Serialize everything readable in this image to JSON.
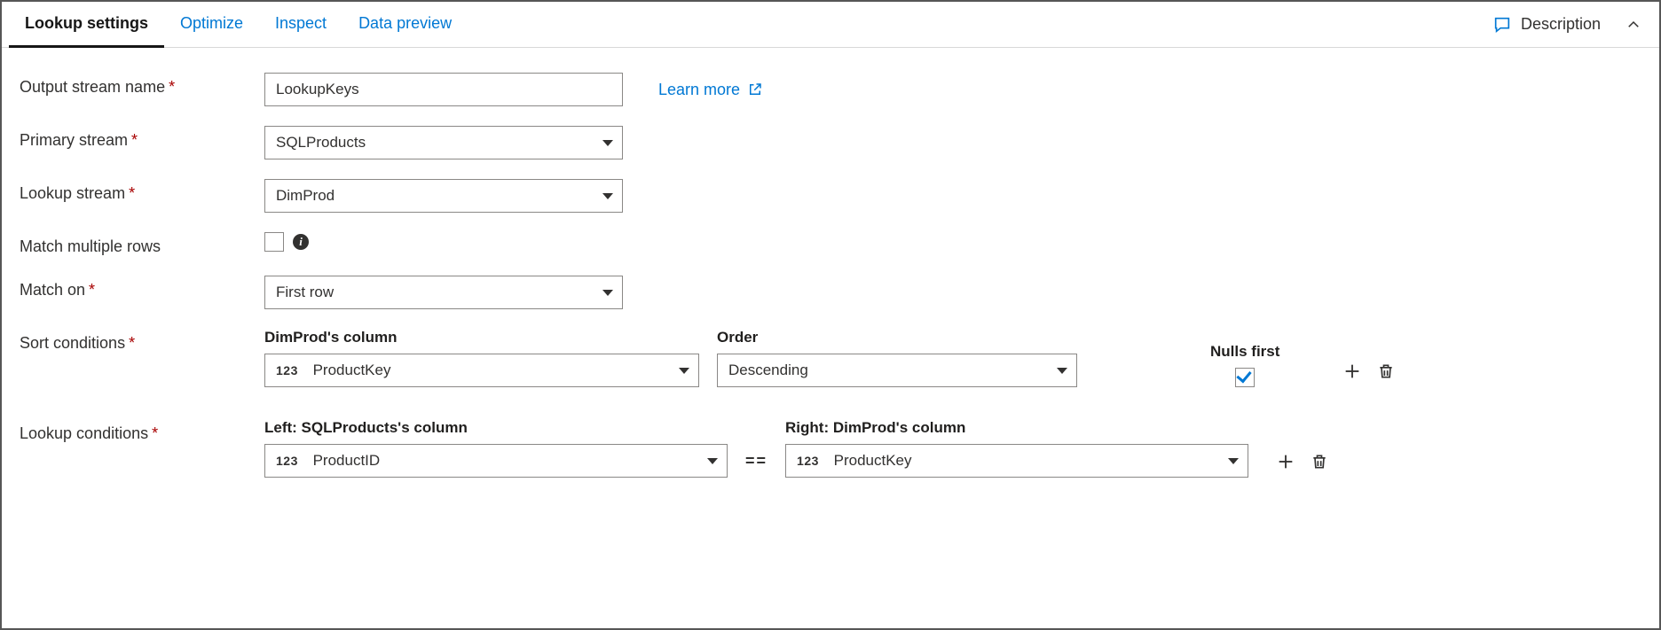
{
  "tabs": {
    "lookup_settings": "Lookup settings",
    "optimize": "Optimize",
    "inspect": "Inspect",
    "data_preview": "Data preview"
  },
  "header": {
    "description": "Description"
  },
  "form": {
    "output_stream_label": "Output stream name",
    "output_stream_value": "LookupKeys",
    "learn_more": "Learn more",
    "primary_stream_label": "Primary stream",
    "primary_stream_value": "SQLProducts",
    "lookup_stream_label": "Lookup stream",
    "lookup_stream_value": "DimProd",
    "match_multiple_rows_label": "Match multiple rows",
    "match_on_label": "Match on",
    "match_on_value": "First row"
  },
  "sort": {
    "label": "Sort conditions",
    "column_header": "DimProd's column",
    "column_type": "123",
    "column_value": "ProductKey",
    "order_header": "Order",
    "order_value": "Descending",
    "nulls_header": "Nulls first"
  },
  "lookup": {
    "label": "Lookup conditions",
    "left_header": "Left: SQLProducts's column",
    "left_type": "123",
    "left_value": "ProductID",
    "operator": "==",
    "right_header": "Right: DimProd's column",
    "right_type": "123",
    "right_value": "ProductKey"
  }
}
